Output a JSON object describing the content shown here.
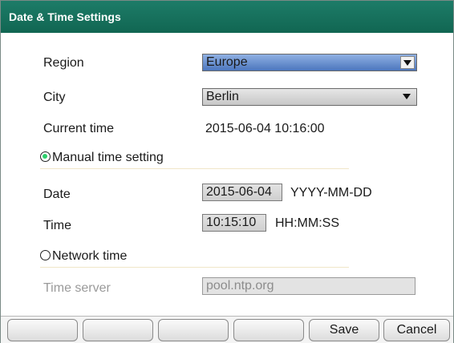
{
  "window": {
    "title": "Date & Time Settings"
  },
  "form": {
    "region_label": "Region",
    "region_value": "Europe",
    "city_label": "City",
    "city_value": "Berlin",
    "current_time_label": "Current time",
    "current_time_value": "2015-06-04 10:16:00",
    "manual_label": "Manual time setting",
    "date_label": "Date",
    "date_value": "2015-06-04",
    "date_format": "YYYY-MM-DD",
    "time_label": "Time",
    "time_value": "10:15:10",
    "time_format": "HH:MM:SS",
    "network_label": "Network time",
    "server_label": "Time server",
    "server_value": "pool.ntp.org"
  },
  "footer": {
    "buttons": [
      "",
      "",
      "",
      "",
      "Save",
      "Cancel"
    ]
  },
  "colors": {
    "titlebar": "#137160",
    "selected_dropdown": "#5a82c4",
    "radio_checked": "#2ccf6a"
  }
}
